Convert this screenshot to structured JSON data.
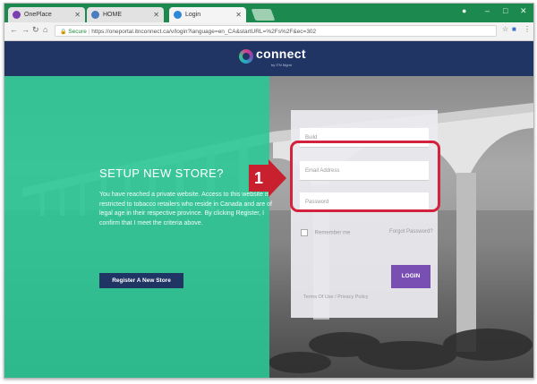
{
  "browser": {
    "tabs": [
      {
        "title": "OnePlace",
        "icon": "oneplace-favicon-icon",
        "color": "#7a3fb0"
      },
      {
        "title": "HOME",
        "icon": "home-favicon-icon",
        "color": "#4a7cc0"
      },
      {
        "title": "Login",
        "icon": "login-favicon-icon",
        "color": "#2d88d8"
      }
    ],
    "url_secure_label": "Secure",
    "url": "https://oneportal.itnconnect.ca/v/login?language=en_CA&startURL=%2Fs%2F&ec=302",
    "colors": {
      "tabstrip": "#1c8a4e"
    }
  },
  "site": {
    "logo_text": "connect",
    "logo_subtext": "by ITN Mgmt",
    "colors": {
      "header": "#213565",
      "green_overlay": "#2ac896",
      "login_button": "#7a4fb3"
    }
  },
  "promo": {
    "heading": "SETUP NEW STORE?",
    "body": "You have reached a private website. Access to this website is restricted to tobacco retailers who reside in Canada and are of legal age in their respective province. By clicking Register, I confirm that I meet the criteria above.",
    "register_label": "Register A New Store"
  },
  "login": {
    "username_placeholder": "Build",
    "email_placeholder": "Email Address",
    "password_placeholder": "Password",
    "remember_label": "Remember me",
    "forgot_label": "Forgot Password?",
    "login_label": "LOGIN",
    "footer_links": "Terms Of Use / Privacy Policy"
  },
  "annotation": {
    "step_number": "1",
    "color": "#d4213d"
  }
}
